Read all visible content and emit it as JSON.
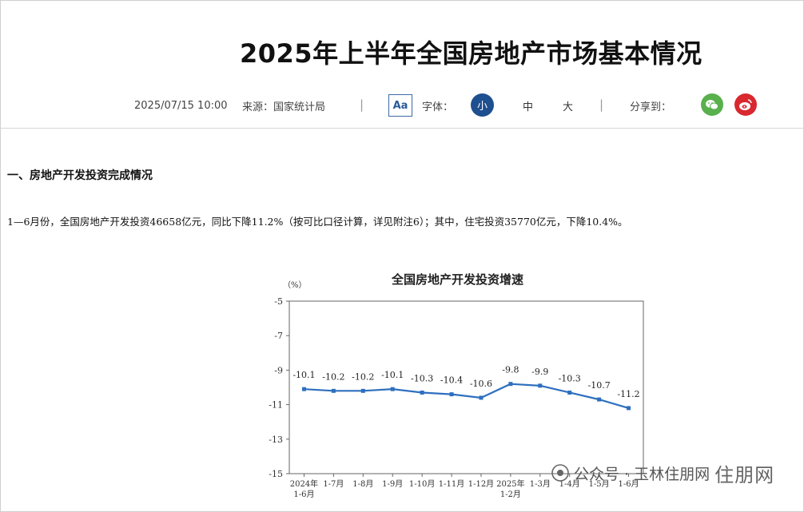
{
  "article": {
    "title": "2025年上半年全国房地产市场基本情况",
    "date": "2025/07/15 10:00",
    "source": "来源：国家统计局",
    "font_label": "字体：",
    "font_sizes": [
      "小",
      "中",
      "大"
    ],
    "font_icon_label": "Aa",
    "share_label": "分享到：",
    "separator": "|"
  },
  "share": {
    "wechat_icon": "wechat-icon",
    "weibo_icon": "weibo-icon",
    "wechat_color": "#59b04c",
    "weibo_color": "#d9282f"
  },
  "body": {
    "heading": "一、房地产开发投资完成情况",
    "paragraph": "1—6月份，全国房地产开发投资46658亿元，同比下降11.2%（按可比口径计算，详见附注6）；其中，住宅投资35770亿元，下降10.4%。"
  },
  "chart_data": {
    "type": "line",
    "title": "全国房地产开发投资增速",
    "y_unit": "（%）",
    "categories": [
      "2024年\n1-6月",
      "1-7月",
      "1-8月",
      "1-9月",
      "1-10月",
      "1-11月",
      "1-12月",
      "2025年\n1-2月",
      "1-3月",
      "1-4月",
      "1-5月",
      "1-6月"
    ],
    "values": [
      -10.1,
      -10.2,
      -10.2,
      -10.1,
      -10.3,
      -10.4,
      -10.6,
      -9.8,
      -9.9,
      -10.3,
      -10.7,
      -11.2
    ],
    "ylim": [
      -15,
      -5
    ],
    "yticks": [
      -5,
      -7,
      -9,
      -11,
      -13,
      -15
    ],
    "line_color": "#2e6fbf",
    "grid": false
  },
  "watermark": {
    "account_label": "公众号 · 玉林住朋网",
    "logo_mark": "住朋网"
  }
}
